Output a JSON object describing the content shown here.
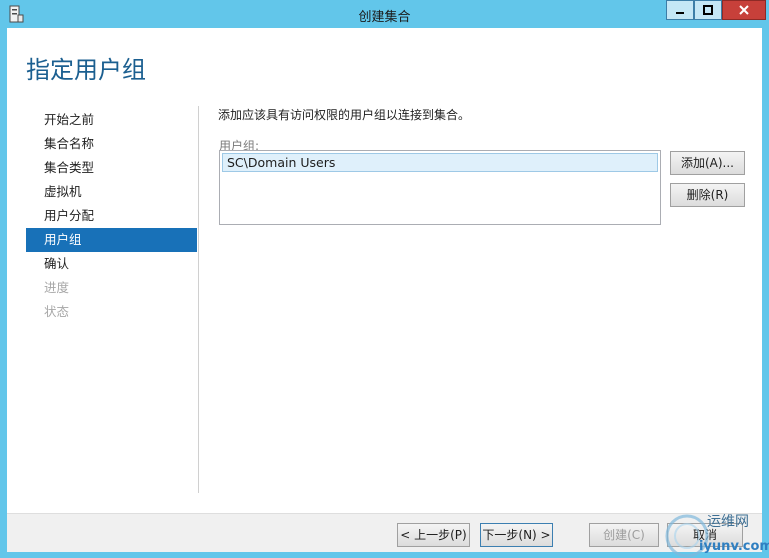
{
  "window": {
    "title": "创建集合"
  },
  "page_title": "指定用户组",
  "steps": [
    {
      "label": "开始之前",
      "state": "normal"
    },
    {
      "label": "集合名称",
      "state": "normal"
    },
    {
      "label": "集合类型",
      "state": "normal"
    },
    {
      "label": "虚拟机",
      "state": "normal"
    },
    {
      "label": "用户分配",
      "state": "normal"
    },
    {
      "label": "用户组",
      "state": "active"
    },
    {
      "label": "确认",
      "state": "normal"
    },
    {
      "label": "进度",
      "state": "disabled"
    },
    {
      "label": "状态",
      "state": "disabled"
    }
  ],
  "main": {
    "instruction": "添加应该具有访问权限的用户组以连接到集合。",
    "group_label": "用户组:",
    "groups": [
      "SC\\Domain Users"
    ],
    "add_button": "添加(A)...",
    "delete_button": "删除(R)"
  },
  "footer": {
    "prev": "< 上一步(P)",
    "next": "下一步(N) >",
    "create": "创建(C)",
    "cancel": "取消"
  },
  "watermark": {
    "text": "运维网",
    "url_text": "iyunv.com"
  },
  "colors": {
    "titlebar": "#62c6ea",
    "active_step": "#1871b8",
    "page_title": "#1b5f90"
  }
}
